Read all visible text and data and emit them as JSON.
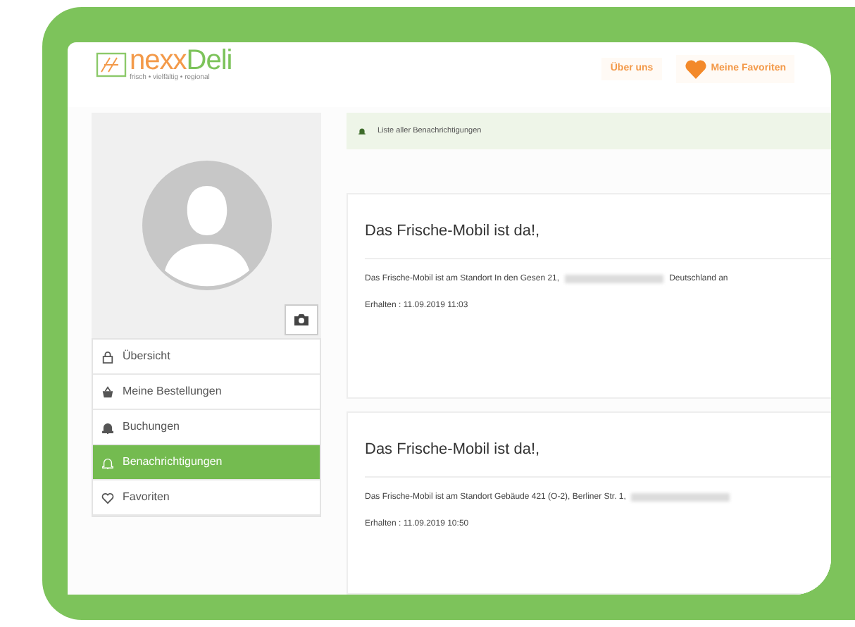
{
  "header": {
    "logo": {
      "part_1": "nexx",
      "part_2": "Deli",
      "tagline": "frisch • vielfältig • regional"
    },
    "nav": [
      {
        "label": "Über uns",
        "kind": "text"
      },
      {
        "label": "Meine Favoriten",
        "kind": "heart"
      }
    ]
  },
  "sidebar": {
    "items": [
      {
        "label": "Übersicht",
        "kind": "lock",
        "selected": false
      },
      {
        "label": "Meine Bestellungen",
        "kind": "basket",
        "selected": false
      },
      {
        "label": "Buchungen",
        "kind": "bell",
        "selected": false
      },
      {
        "label": "Benachrichtigungen",
        "kind": "bell",
        "selected": true
      },
      {
        "label": "Favoriten",
        "kind": "heart",
        "selected": false
      }
    ]
  },
  "notice": {
    "text": "Liste aller Benachrichtigungen"
  },
  "notifications": [
    {
      "title": "Das Frische-Mobil ist da!,",
      "body_start": "Das Frische-Mobil ist am Standort In den Gesen 21,",
      "body_end": "Deutschland an",
      "received": "Erhalten : 11.09.2019 11:03"
    },
    {
      "title": "Das Frische-Mobil ist da!,",
      "body_start": "Das Frische-Mobil ist am Standort Gebäude 421 (O-2), Berliner Str. 1,",
      "received": "Erhalten : 11.09.2019 10:50"
    }
  ]
}
